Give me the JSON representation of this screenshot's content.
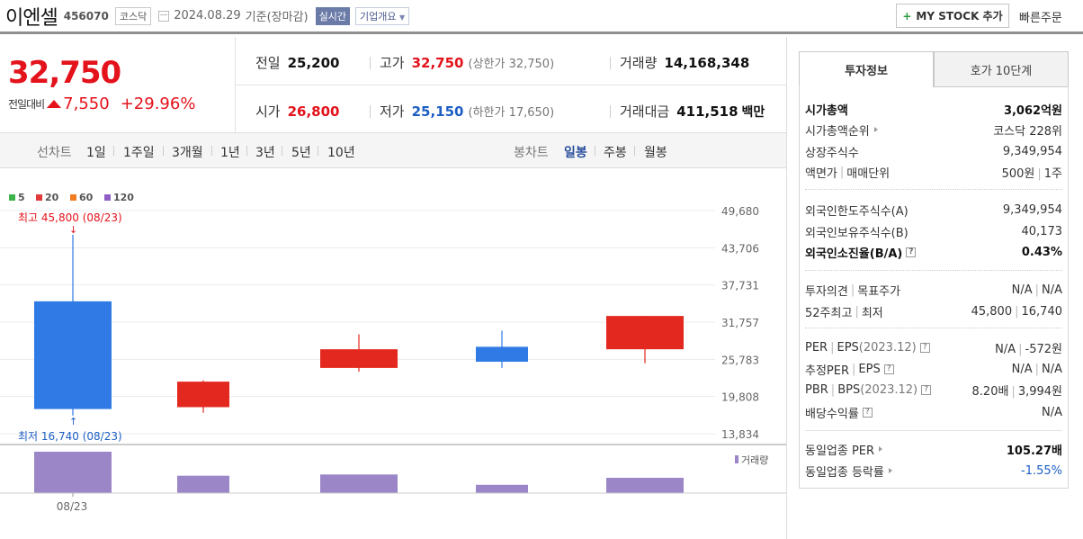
{
  "header": {
    "company_name": "이엔셀",
    "stock_code": "456070",
    "market_tag": "코스닥",
    "date": "2024.08.29",
    "date_suffix": "기준(장마감)",
    "realtime_label": "실시간",
    "company_info_label": "기업개요",
    "mystock_label": "MY STOCK 추가",
    "quick_order_label": "빠른주문"
  },
  "quote": {
    "current_price": "32,750",
    "diff_label": "전일대비",
    "diff_value": "7,550",
    "diff_percent": "+29.96%",
    "prev_close_label": "전일",
    "prev_close": "25,200",
    "high_label": "고가",
    "high": "32,750",
    "upper_limit": "(상한가 32,750)",
    "volume_label": "거래량",
    "volume": "14,168,348",
    "open_label": "시가",
    "open": "26,800",
    "low_label": "저가",
    "low": "25,150",
    "lower_limit": "(하한가 17,650)",
    "trade_value_label": "거래대금",
    "trade_value": "411,518",
    "trade_value_unit": "백만"
  },
  "period_tabs": {
    "line_chart_label": "선차트",
    "ranges": [
      "1일",
      "1주일",
      "3개월",
      "1년",
      "3년",
      "5년",
      "10년"
    ],
    "candle_label": "봉차트",
    "candle_types": [
      "일봉",
      "주봉",
      "월봉"
    ],
    "selected_candle": "일봉"
  },
  "chart_data": {
    "type": "candlestick",
    "moving_average_legend": [
      {
        "name": "5",
        "color": "#3cb44b"
      },
      {
        "name": "20",
        "color": "#e23a3a"
      },
      {
        "name": "60",
        "color": "#f07d22"
      },
      {
        "name": "120",
        "color": "#8e5ec4"
      }
    ],
    "y_ticks": [
      49680,
      43706,
      37731,
      31757,
      25783,
      19808,
      13834
    ],
    "y_tick_labels": [
      "49,680",
      "43,706",
      "37,731",
      "31,757",
      "25,783",
      "19,808",
      "13,834"
    ],
    "ylim": [
      13834,
      49680
    ],
    "candles": [
      {
        "open": 35100,
        "high": 45800,
        "low": 16740,
        "close": 17800,
        "direction": "down",
        "volume": 1.0
      },
      {
        "open": 18100,
        "high": 22400,
        "low": 17200,
        "close": 22200,
        "direction": "up",
        "volume": 0.42
      },
      {
        "open": 24400,
        "high": 29800,
        "low": 23800,
        "close": 27400,
        "direction": "up",
        "volume": 0.45
      },
      {
        "open": 27800,
        "high": 30400,
        "low": 24400,
        "close": 25400,
        "direction": "down",
        "volume": 0.2
      },
      {
        "open": 27400,
        "high": 32750,
        "low": 25150,
        "close": 32750,
        "direction": "up",
        "volume": 0.37
      }
    ],
    "high_annotation": "최고 45,800 (08/23)",
    "low_annotation": "최저 16,740 (08/23)",
    "volume_label": "거래량",
    "x_label": "08/23",
    "up_color": "#e3281f",
    "down_color": "#2f7ae5",
    "volume_color": "#9b86c8"
  },
  "panel": {
    "tabs": [
      "투자정보",
      "호가 10단계"
    ],
    "active_tab": "투자정보",
    "market_cap_label": "시가총액",
    "market_cap": "3,062억원",
    "market_cap_rank_label": "시가총액순위",
    "market_cap_rank": "코스닥 228위",
    "listed_shares_label": "상장주식수",
    "listed_shares": "9,349,954",
    "face_value_label": "액면가",
    "trade_unit_label": "매매단위",
    "face_value": "500원",
    "trade_unit": "1주",
    "foreign_limit_label": "외국인한도주식수(A)",
    "foreign_limit": "9,349,954",
    "foreign_hold_label": "외국인보유주식수(B)",
    "foreign_hold": "40,173",
    "foreign_ratio_label": "외국인소진율(B/A)",
    "foreign_ratio": "0.43%",
    "opinion_label": "투자의견",
    "target_label": "목표주가",
    "opinion": "N/A",
    "target": "N/A",
    "week52_label": "52주최고",
    "week52_low_label": "최저",
    "week52_high": "45,800",
    "week52_low": "16,740",
    "per_label": "PER",
    "eps_label": "EPS",
    "eps_year": "(2023.12)",
    "per": "N/A",
    "eps": "-572원",
    "est_per_label": "추정PER",
    "est_eps_label": "EPS",
    "est_per": "N/A",
    "est_eps": "N/A",
    "pbr_label": "PBR",
    "bps_label": "BPS",
    "bps_year": "(2023.12)",
    "pbr": "8.20배",
    "bps": "3,994원",
    "dividend_label": "배당수익률",
    "dividend": "N/A",
    "sector_per_label": "동일업종 PER",
    "sector_per": "105.27배",
    "sector_change_label": "동일업종 등락률",
    "sector_change": "-1.55%"
  }
}
